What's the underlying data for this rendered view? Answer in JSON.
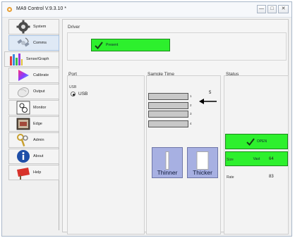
{
  "window": {
    "title": "MA9 Control V.9.3.10 *",
    "minimize": "—",
    "maximize": "□",
    "close": "✕"
  },
  "sidebar": {
    "items": [
      {
        "label": "System",
        "icon": "gear-icon"
      },
      {
        "label": "Comms",
        "icon": "satellite-icon"
      },
      {
        "label": "Sense/Graph",
        "icon": "bar-graph-icon"
      },
      {
        "label": "Calibrate",
        "icon": "color-triangle-icon"
      },
      {
        "label": "Output",
        "icon": "mouse-icon"
      },
      {
        "label": "Monitor",
        "icon": "monitor-doodle-icon"
      },
      {
        "label": "Edge",
        "icon": "edge-picture-icon"
      },
      {
        "label": "Admin",
        "icon": "keys-icon"
      },
      {
        "label": "About",
        "icon": "info-icon"
      },
      {
        "label": "Help",
        "icon": "help-sign-icon"
      }
    ],
    "selected": "Comms"
  },
  "driver": {
    "group_label": "Driver",
    "status_label": "Present"
  },
  "port": {
    "group_label": "Port",
    "usb_heading": "USB",
    "usb_option": "USB"
  },
  "sample_time": {
    "group_label": "Sample Time",
    "top_number": "5",
    "bar_numbers": [
      "1",
      "2",
      "3",
      "4"
    ],
    "thinner_label": "Thinner",
    "thicker_label": "Thicker"
  },
  "status": {
    "group_label": "Status",
    "open_label": "OPEN",
    "vast_label": "Vast",
    "size_label": "Size",
    "size_value": "64",
    "rate_label": "Rate",
    "rate_value": "83"
  },
  "colors": {
    "button_green": "#2df02d",
    "thick_button": "#a7b0e2",
    "selected_nav": "#dfe9f5"
  }
}
